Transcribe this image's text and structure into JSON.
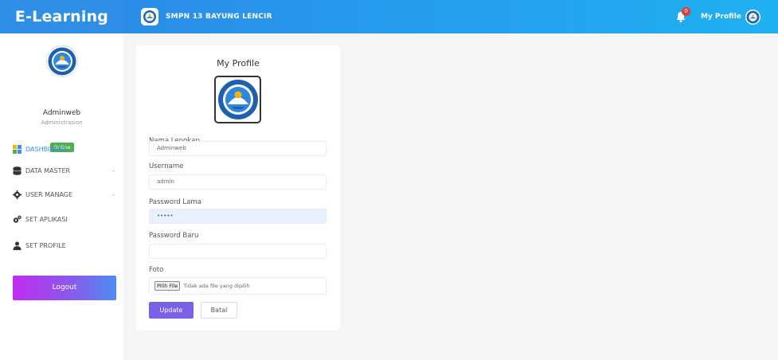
{
  "app": {
    "brand": "E-Learning",
    "school_name": "SMPN 13 BAYUNG LENCIR",
    "notification_count": "0",
    "profile_link": "My Profile"
  },
  "colors": {
    "brand_blue": "#2f8fe6",
    "active_menu": "#3a8ee8",
    "online_green": "#4caf50",
    "update_purple": "#7b61e8",
    "badge_red": "#e53935"
  },
  "sidebar": {
    "user_name": "Adminweb",
    "user_role": "Administrasion",
    "status": "Online",
    "items": [
      {
        "label": "DASHBOARD",
        "icon": "dashboard-icon",
        "active": true
      },
      {
        "label": "DATA MASTER",
        "icon": "database-icon",
        "chevron": "-"
      },
      {
        "label": "USER MANAGE",
        "icon": "gear-icon",
        "chevron": "-"
      },
      {
        "label": "SET APLIKASI",
        "icon": "gears-icon"
      },
      {
        "label": "SET PROFILE",
        "icon": "user-icon"
      }
    ],
    "logout_label": "Logout"
  },
  "profile_form": {
    "title": "My Profile",
    "fields": [
      {
        "label": "Nama Lengkap",
        "value": "Adminweb"
      },
      {
        "label": "Username",
        "value": "admin"
      },
      {
        "label": "Password Lama",
        "value": "•••••"
      },
      {
        "label": "Password Baru",
        "value": ""
      }
    ],
    "photo_label": "Foto",
    "file_button": "Pilih File",
    "file_status": "Tidak ada file yang dipilih",
    "update_label": "Update",
    "cancel_label": "Batal"
  }
}
